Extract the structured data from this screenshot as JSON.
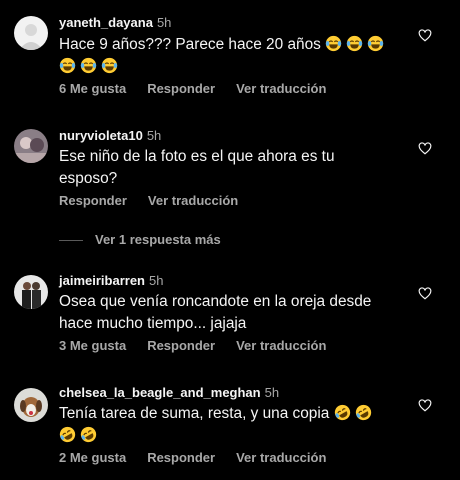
{
  "colors": {
    "background": "#000000",
    "text": "#f5f5f5",
    "muted": "#a8a8a8"
  },
  "comments": [
    {
      "username": "yaneth_dayana",
      "time": "5h",
      "line1": "Hace 9 años??? Parece hace 20 años",
      "emoji_line1": "laughing-tears-emoji x3",
      "emoji_line2": "laughing-tears-emoji x3",
      "likes": "6 Me gusta",
      "reply": "Responder",
      "translate": "Ver traducción"
    },
    {
      "username": "nuryvioleta10",
      "time": "5h",
      "text": "Ese niño de la foto es el que ahora es tu esposo?",
      "reply": "Responder",
      "translate": "Ver traducción"
    },
    {
      "username": "jaimeiribarren",
      "time": "5h",
      "text": "Osea que venía roncandote en la oreja desde hace mucho tiempo... jajaja",
      "likes": "3 Me gusta",
      "reply": "Responder",
      "translate": "Ver traducción"
    },
    {
      "username": "chelsea_la_beagle_and_meghan",
      "time": "5h",
      "line1": "Tenía tarea de suma, resta, y una copia",
      "emoji_line1": "rofl-emoji x2",
      "emoji_line2": "rofl-emoji x2",
      "likes": "2 Me gusta",
      "reply": "Responder",
      "translate": "Ver traducción"
    }
  ],
  "view_replies": "Ver 1 respuesta más",
  "icons": {
    "like": "heart-outline-icon"
  }
}
